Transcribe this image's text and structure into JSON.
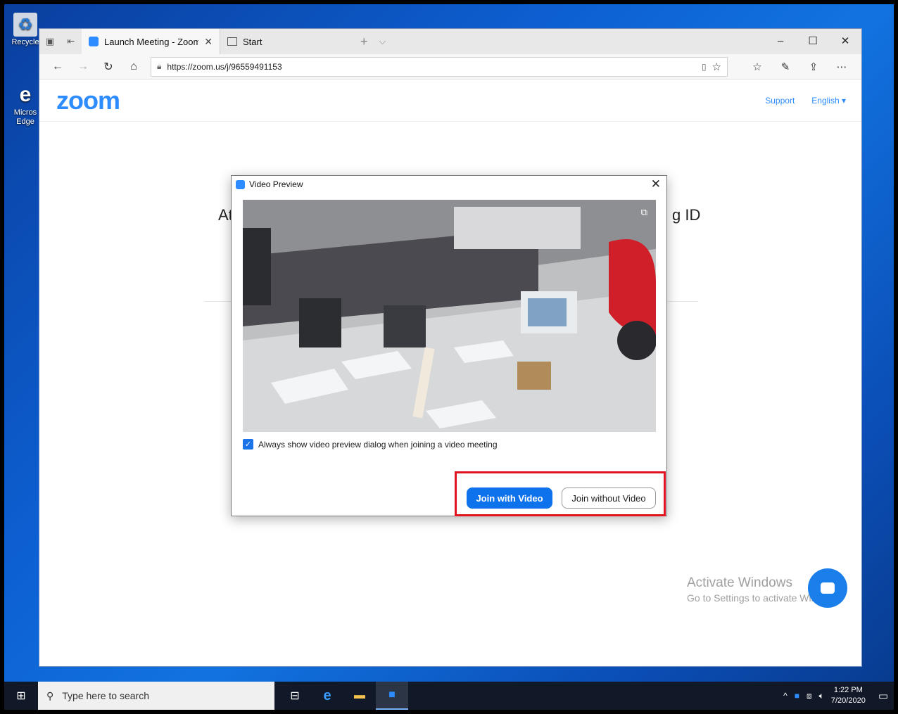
{
  "desktop": {
    "icons": [
      {
        "label": "Recycle",
        "icon": "recycle-bin-icon"
      },
      {
        "label": "Micros\nEdge",
        "icon": "edge-icon"
      }
    ]
  },
  "browser": {
    "tabs": [
      {
        "title": "Launch Meeting - Zoom",
        "active": true
      },
      {
        "title": "Start",
        "active": false
      }
    ],
    "url": "https://zoom.us/j/96559491153",
    "window_controls": {
      "minimize": "–",
      "maximize": "☐",
      "close": "✕"
    }
  },
  "page": {
    "logo": "zoom",
    "links": {
      "support": "Support",
      "language": "English ▾"
    },
    "partial_left": "At",
    "partial_right": "g ID",
    "watermark": {
      "line1": "Activate Windows",
      "line2": "Go to Settings to activate Windows."
    }
  },
  "dialog": {
    "title": "Video Preview",
    "checkbox_label": "Always show video preview dialog when joining a video meeting",
    "checkbox_checked": true,
    "join_with_video": "Join with Video",
    "join_without_video": "Join without Video"
  },
  "taskbar": {
    "search_placeholder": "Type here to search",
    "time": "1:22 PM",
    "date": "7/20/2020"
  },
  "colors": {
    "accent": "#0e72ed",
    "zoom_brand": "#2d8cff",
    "highlight": "#e0141e"
  }
}
